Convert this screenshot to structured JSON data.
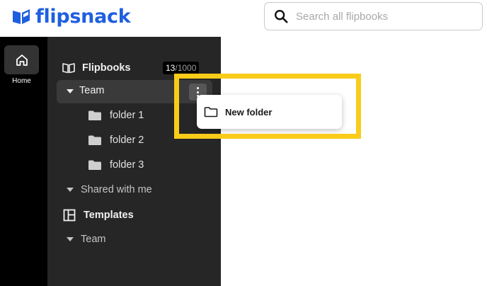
{
  "app": {
    "brand": "flipsnack",
    "brand_color": "#1f5fe0"
  },
  "search": {
    "placeholder": "Search all flipbooks"
  },
  "rail": {
    "home_label": "Home"
  },
  "sidebar": {
    "flipbooks_label": "Flipbooks",
    "counter": {
      "used": "13",
      "separator": "/",
      "max": "1000"
    },
    "team_label": "Team",
    "folders": [
      "folder 1",
      "folder 2",
      "folder 3"
    ],
    "shared_label": "Shared with me",
    "templates_label": "Templates",
    "templates_team_label": "Team"
  },
  "context_menu": {
    "new_folder_label": "New folder"
  },
  "highlight": {
    "color": "#f9cc1a"
  }
}
